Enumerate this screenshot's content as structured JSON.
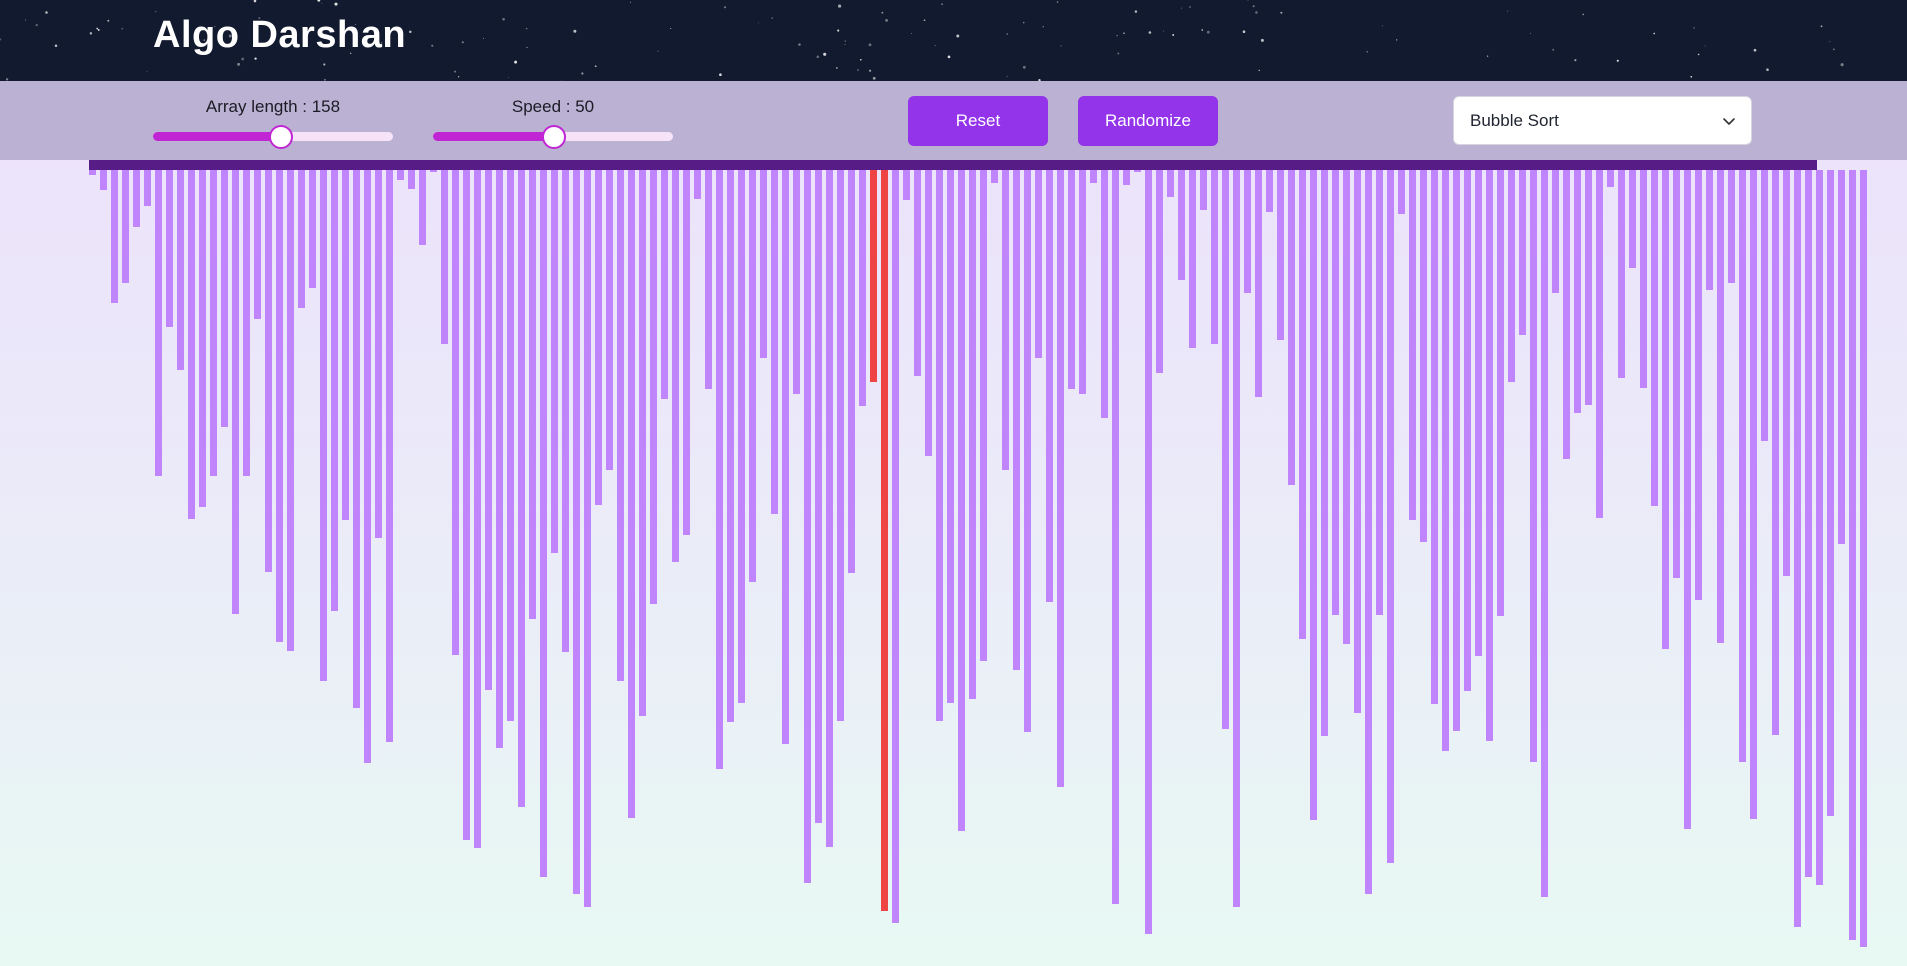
{
  "header": {
    "title": "Algo Darshan"
  },
  "controls": {
    "array_length": {
      "label": "Array length : ",
      "value": "158",
      "fraction": 0.53
    },
    "speed": {
      "label": "Speed : ",
      "value": "50",
      "fraction": 0.5
    },
    "reset_label": "Reset",
    "randomize_label": "Randomize",
    "algorithm": {
      "selected": "Bubble Sort"
    }
  },
  "colors": {
    "header_bg": "#111a2e",
    "accent": "#9333ea",
    "slider": "#c026d3",
    "bar": "#c084fc",
    "bar_active": "#ef4444",
    "bar_top": "#581c87"
  },
  "icons": [
    "chevron-down-icon"
  ],
  "visualization": {
    "active_indices": [
      71,
      72
    ],
    "values": [
      5,
      20,
      133,
      113,
      57,
      36,
      306,
      157,
      200,
      349,
      337,
      306,
      257,
      444,
      306,
      149,
      402,
      472,
      481,
      138,
      118,
      511,
      441,
      350,
      538,
      593,
      368,
      572,
      10,
      19,
      75,
      0,
      174,
      485,
      670,
      678,
      520,
      578,
      551,
      637,
      449,
      707,
      383,
      482,
      724,
      737,
      335,
      300,
      511,
      648,
      546,
      434,
      229,
      392,
      365,
      29,
      219,
      599,
      552,
      533,
      412,
      188,
      344,
      574,
      224,
      713,
      653,
      677,
      551,
      403,
      236,
      212,
      741,
      753,
      30,
      206,
      286,
      551,
      533,
      661,
      529,
      491,
      13,
      300,
      500,
      562,
      188,
      432,
      617,
      219,
      224,
      13,
      248,
      734,
      15,
      1,
      764,
      203,
      27,
      110,
      178,
      40,
      174,
      559,
      737,
      123,
      227,
      42,
      170,
      315,
      469,
      650,
      566,
      445,
      474,
      543,
      724,
      445,
      693,
      44,
      350,
      372,
      534,
      581,
      561,
      521,
      486,
      571,
      446,
      212,
      165,
      592,
      727,
      123,
      289,
      243,
      235,
      348,
      17,
      208,
      98,
      218,
      336,
      479,
      408,
      659,
      430,
      120,
      473,
      113,
      592,
      649,
      271,
      565,
      406,
      757,
      707,
      715,
      646,
      374,
      770,
      777
    ]
  }
}
